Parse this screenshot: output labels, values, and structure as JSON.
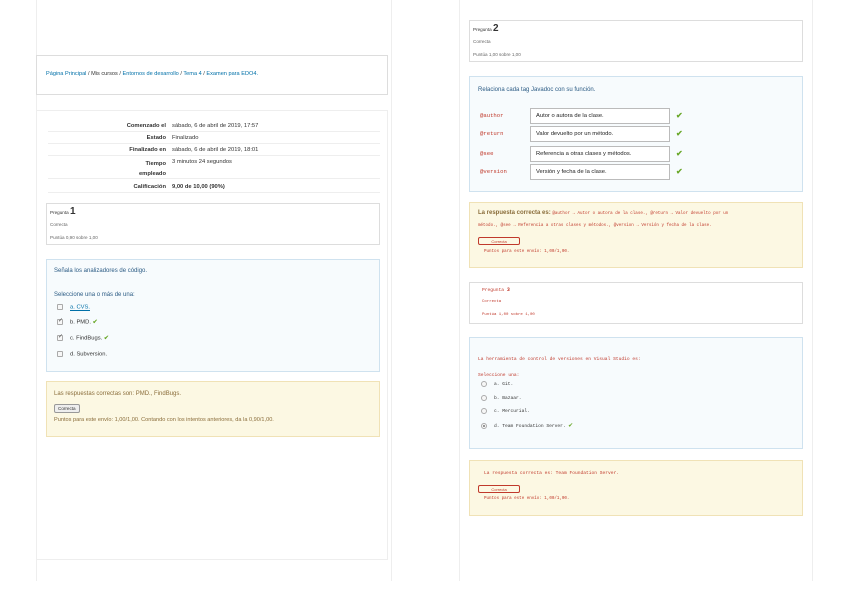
{
  "breadcrumb": {
    "home": "Página Principal",
    "sep1": " / ",
    "my_courses": "Mis cursos",
    "sep2": " / ",
    "course": "Entornos de desarrollo",
    "sep3": " / ",
    "topic": "Tema 4",
    "sep4": " / ",
    "exam": "Examen para EDO4."
  },
  "summary": [
    {
      "label": "Comenzado el",
      "value": "sábado, 6 de abril de 2019, 17:57"
    },
    {
      "label": "Estado",
      "value": "Finalizado"
    },
    {
      "label": "Finalizado en",
      "value": "sábado, 6 de abril de 2019, 18:01"
    },
    {
      "label": "Tiempo empleado",
      "value": "3 minutos 24 segundos"
    },
    {
      "label": "Calificación",
      "value": "9,00 de 10,00 (90%)"
    }
  ],
  "q1": {
    "prefix": "Pregunta",
    "number": "1",
    "state": "Correcta",
    "grade": "Puntúa 0,90 sobre 1,00",
    "text": "Señala los analizadores de código.",
    "prompt": "Seleccione una o más de una:",
    "options": [
      {
        "label": "a. CVS.",
        "checked": false,
        "correct": false
      },
      {
        "label": "b. PMD.",
        "checked": true,
        "correct": true
      },
      {
        "label": "c. FindBugs.",
        "checked": true,
        "correct": true
      },
      {
        "label": "d. Subversion.",
        "checked": false,
        "correct": false
      }
    ],
    "feedback": "Las respuestas correctas son: PMD., FindBugs.",
    "button": "Correcta",
    "points": "Puntos para este envío: 1,00/1,00. Contando con los intentos anteriores, da la 0,90/1,00."
  },
  "q2": {
    "prefix": "Pregunta",
    "number": "2",
    "state": "Correcta",
    "grade": "Puntúa 1,00 sobre 1,00",
    "text": "Relaciona cada tag Javadoc con su función.",
    "rows": [
      {
        "tag": "@author",
        "answer": "Autor o autora de la clase."
      },
      {
        "tag": "@return",
        "answer": "Valor devuelto por un método."
      },
      {
        "tag": "@see",
        "answer": "Referencia a otras clases y métodos."
      },
      {
        "tag": "@version",
        "answer": "Versión y fecha de la clase."
      }
    ],
    "feedback_label": "La respuesta correcta es:",
    "feedback_line1": "@author → Autor o autora de la clase., @return → Valor devuelto por un",
    "feedback_line2": "método., @see → Referencia a otras clases y métodos., @version → Versión y fecha de la clase.",
    "button": "Correcta",
    "points": "Puntos para este envío: 1,00/1,00."
  },
  "q3": {
    "prefix": "Pregunta",
    "number": "3",
    "state": "Correcta",
    "grade": "Puntúa 1,00 sobre 1,00",
    "text": "La herramienta de control de versiones en Visual Studio es:",
    "prompt": "Seleccione una:",
    "options": [
      {
        "label": "a. Git.",
        "checked": false,
        "correct": false
      },
      {
        "label": "b. Bazaar.",
        "checked": false,
        "correct": false
      },
      {
        "label": "c. Mercurial.",
        "checked": false,
        "correct": false
      },
      {
        "label": "d. Team Foundation Server.",
        "checked": true,
        "correct": true
      }
    ],
    "feedback": "La respuesta correcta es: Team Foundation Server.",
    "button": "Correcta",
    "points": "Puntos para este envío: 1,00/1,00."
  },
  "colors": {
    "link": "#0070a8",
    "correct": "#6aa82a",
    "tag": "#c0392b",
    "feedback_bg": "#fcf8e3"
  }
}
